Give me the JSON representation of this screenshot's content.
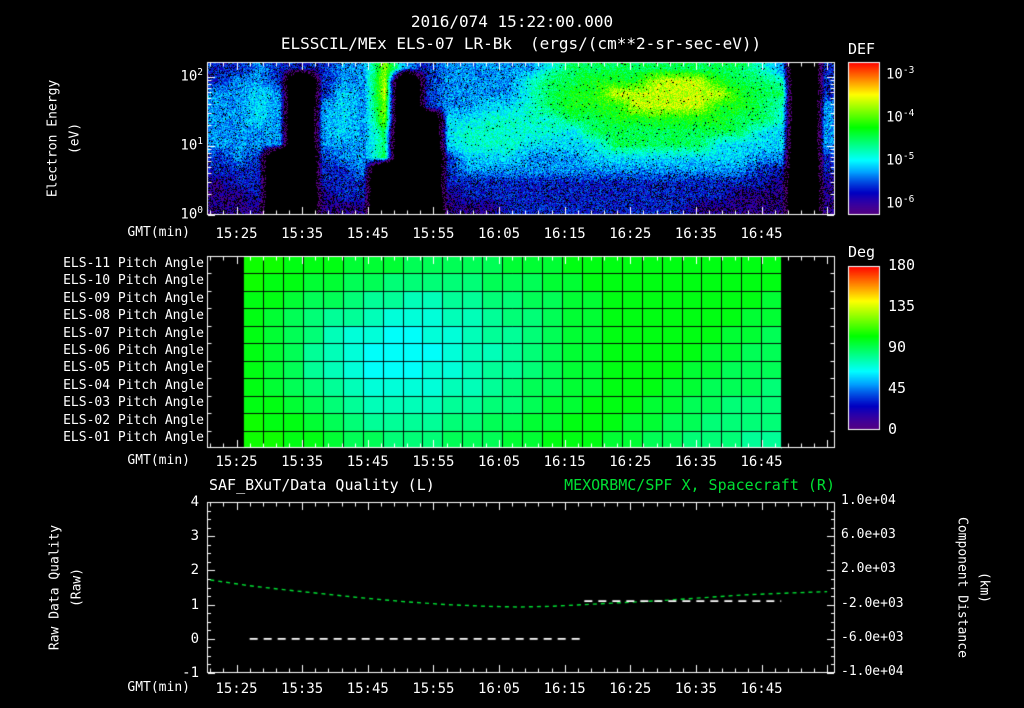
{
  "header": {
    "datetime": "2016/074 15:22:00.000",
    "instrument_title": "ELSSCIL/MEx ELS-07 LR-Bk",
    "units_title": "(ergs/(cm**2-sr-sec-eV))"
  },
  "time_axis": {
    "label": "GMT(min)",
    "tick_labels": [
      "15:25",
      "15:35",
      "15:45",
      "15:55",
      "16:05",
      "16:15",
      "16:25",
      "16:35",
      "16:45"
    ]
  },
  "spectrogram_panel": {
    "ylabel": "Electron Energy",
    "ylabel_units": "(eV)",
    "ytick_exponents": [
      "2",
      "1",
      "0"
    ],
    "colorbar_title": "DEF",
    "colorbar_tick_exponents": [
      "-3",
      "-4",
      "-5",
      "-6"
    ]
  },
  "pitch_panel": {
    "row_labels": [
      "ELS-11 Pitch Angle",
      "ELS-10 Pitch Angle",
      "ELS-09 Pitch Angle",
      "ELS-08 Pitch Angle",
      "ELS-07 Pitch Angle",
      "ELS-06 Pitch Angle",
      "ELS-05 Pitch Angle",
      "ELS-04 Pitch Angle",
      "ELS-03 Pitch Angle",
      "ELS-02 Pitch Angle",
      "ELS-01 Pitch Angle"
    ],
    "colorbar_title": "Deg",
    "colorbar_ticks": [
      "180",
      "135",
      "90",
      "45",
      "0"
    ]
  },
  "bottom_panel": {
    "title_left": "SAF_BXuT/Data Quality (L)",
    "title_right": "MEXORBMC/SPF X, Spacecraft (R)",
    "ylabel_left": "Raw Data Quality",
    "ylabel_left_units": "(Raw)",
    "ylabel_right": "Component Distance",
    "ylabel_right_units": "(km)",
    "left_ticks": [
      "4",
      "3",
      "2",
      "1",
      "0",
      "-1"
    ],
    "right_ticks": [
      "1.0e+04",
      "6.0e+03",
      "2.0e+03",
      "-2.0e+03",
      "-6.0e+03",
      "-1.0e+04"
    ]
  },
  "colors": {
    "background": "#000000",
    "text": "#ffffff",
    "accent_green": "#00e033"
  },
  "chart_data": [
    {
      "id": "electron_energy_spectrogram",
      "type": "heatmap",
      "title": "ELSSCIL/MEx ELS-07 LR-Bk",
      "units": "ergs/(cm**2-sr-sec-eV)",
      "x_range": [
        "15:20",
        "16:56"
      ],
      "x_tick_labels": [
        "15:25",
        "15:35",
        "15:45",
        "15:55",
        "16:05",
        "16:15",
        "16:25",
        "16:35",
        "16:45"
      ],
      "y_scale": "log",
      "y_range_ev": [
        1,
        165
      ],
      "value_scale": "log10(DEF)",
      "value_range": [
        -6,
        -3
      ],
      "rows_top_to_bottom_ev": [
        160,
        100,
        63,
        40,
        25,
        16,
        10,
        6.3,
        4,
        2.5,
        1.6,
        1
      ],
      "no_data_value": -9,
      "values_log10": [
        [
          -5.5,
          -5.5,
          -5.2,
          -5.5,
          -5.5,
          -5.5,
          -5.2,
          -5.2,
          -4.0,
          -5.2,
          -5.5,
          -5.2,
          -5.2,
          -5.2,
          -5.2,
          -5.2,
          -4.8,
          -4.5,
          -4.5,
          -4.5,
          -4.5,
          -4.5,
          -4.5,
          -4.5,
          -4.5,
          -4.5,
          -4.8,
          -5.2,
          -9,
          -5.5
        ],
        [
          -5.5,
          -5.2,
          -5.2,
          -5.5,
          -9,
          -5.5,
          -5.2,
          -5.2,
          -3.8,
          -9,
          -5.5,
          -5.2,
          -5.2,
          -5.2,
          -5.2,
          -4.8,
          -4.5,
          -4.5,
          -4.3,
          -4.3,
          -4.3,
          -3.8,
          -3.8,
          -3.8,
          -4.3,
          -4.5,
          -4.5,
          -4.8,
          -9,
          -5.5
        ],
        [
          -5.2,
          -5.2,
          -5.0,
          -5.2,
          -9,
          -5.5,
          -5.0,
          -5.2,
          -3.8,
          -9,
          -5.5,
          -5.2,
          -5.2,
          -5.2,
          -5.2,
          -4.8,
          -4.5,
          -4.3,
          -4.3,
          -3.8,
          -3.8,
          -3.8,
          -3.8,
          -3.8,
          -3.8,
          -4.3,
          -4.5,
          -4.5,
          -9,
          -5.5
        ],
        [
          -5.2,
          -5.2,
          -5.0,
          -5.2,
          -9,
          -5.2,
          -5.0,
          -5.2,
          -4.0,
          -9,
          -5.5,
          -5.2,
          -5.2,
          -5.0,
          -5.0,
          -4.8,
          -4.5,
          -4.3,
          -4.3,
          -4.3,
          -3.8,
          -3.8,
          -3.8,
          -3.8,
          -4.3,
          -4.3,
          -4.5,
          -4.8,
          -9,
          -5.2
        ],
        [
          -5.2,
          -5.2,
          -5.0,
          -5.2,
          -9,
          -5.2,
          -5.0,
          -5.2,
          -4.0,
          -9,
          -9,
          -5.0,
          -5.0,
          -4.8,
          -4.8,
          -4.8,
          -4.8,
          -4.5,
          -4.5,
          -4.3,
          -4.3,
          -4.3,
          -4.3,
          -4.3,
          -4.3,
          -4.5,
          -4.5,
          -4.8,
          -9,
          -5.2
        ],
        [
          -5.2,
          -5.2,
          -5.2,
          -5.2,
          -9,
          -5.2,
          -5.0,
          -5.2,
          -4.5,
          -9,
          -9,
          -5.0,
          -4.8,
          -4.8,
          -4.8,
          -4.8,
          -4.8,
          -5.0,
          -4.5,
          -4.5,
          -4.5,
          -4.5,
          -4.5,
          -4.5,
          -4.5,
          -4.5,
          -5.0,
          -5.0,
          -9,
          -5.2
        ],
        [
          -5.2,
          -5.2,
          -5.2,
          -5.2,
          -9,
          -5.2,
          -5.2,
          -5.2,
          -4.5,
          -9,
          -9,
          -5.0,
          -4.8,
          -4.8,
          -4.8,
          -5.0,
          -5.0,
          -5.0,
          -5.0,
          -4.5,
          -4.5,
          -4.5,
          -4.5,
          -4.5,
          -5.0,
          -5.0,
          -5.0,
          -5.0,
          -9,
          -5.2
        ],
        [
          -5.5,
          -5.2,
          -5.5,
          -9,
          -9,
          -5.5,
          -5.2,
          -5.2,
          -4.5,
          -9,
          -9,
          -5.5,
          -5.0,
          -5.0,
          -5.0,
          -5.2,
          -5.2,
          -5.2,
          -5.0,
          -5.0,
          -5.0,
          -5.0,
          -5.0,
          -5.0,
          -5.0,
          -5.0,
          -5.2,
          -5.2,
          -9,
          -5.5
        ],
        [
          -5.5,
          -5.5,
          -5.5,
          -9,
          -9,
          -5.5,
          -5.5,
          -5.2,
          -9,
          -9,
          -9,
          -5.5,
          -5.2,
          -5.2,
          -5.2,
          -5.2,
          -5.2,
          -5.2,
          -5.2,
          -5.2,
          -5.2,
          -5.2,
          -5.2,
          -5.2,
          -5.2,
          -5.2,
          -5.5,
          -5.5,
          -9,
          -5.5
        ],
        [
          -5.8,
          -5.5,
          -5.5,
          -9,
          -9,
          -5.5,
          -5.5,
          -5.5,
          -9,
          -9,
          -9,
          -5.5,
          -5.5,
          -5.5,
          -5.5,
          -5.5,
          -5.5,
          -5.5,
          -5.5,
          -5.5,
          -5.5,
          -5.5,
          -5.5,
          -5.5,
          -5.5,
          -5.5,
          -5.5,
          -5.8,
          -9,
          -5.8
        ],
        [
          -5.8,
          -5.8,
          -5.5,
          -9,
          -9,
          -5.8,
          -5.5,
          -5.5,
          -9,
          -9,
          -9,
          -5.8,
          -5.5,
          -5.5,
          -5.5,
          -5.5,
          -5.5,
          -5.5,
          -5.5,
          -5.5,
          -5.5,
          -5.5,
          -5.5,
          -5.5,
          -5.5,
          -5.8,
          -5.8,
          -5.8,
          -9,
          -5.8
        ],
        [
          -5.8,
          -5.8,
          -5.8,
          -9,
          -9,
          -5.8,
          -5.8,
          -5.8,
          -9,
          -9,
          -9,
          -5.8,
          -5.8,
          -5.8,
          -5.5,
          -5.5,
          -5.5,
          -5.5,
          -5.5,
          -5.5,
          -5.5,
          -5.5,
          -5.5,
          -5.8,
          -5.8,
          -5.8,
          -5.8,
          -5.8,
          -9,
          -5.8
        ]
      ]
    },
    {
      "id": "pitch_angle_panel",
      "type": "heatmap",
      "x_range": [
        "15:26",
        "16:48"
      ],
      "value_units": "Deg",
      "value_range": [
        0,
        180
      ],
      "rows_top_to_bottom": [
        "ELS-11",
        "ELS-10",
        "ELS-09",
        "ELS-08",
        "ELS-07",
        "ELS-06",
        "ELS-05",
        "ELS-04",
        "ELS-03",
        "ELS-02",
        "ELS-01"
      ],
      "values_deg": [
        [
          105,
          105,
          100,
          100,
          100,
          95,
          95,
          95,
          90,
          90,
          90,
          90,
          90,
          95,
          95,
          95,
          100,
          100,
          100,
          100,
          100,
          100,
          100,
          100,
          100,
          100,
          100
        ],
        [
          105,
          100,
          100,
          95,
          95,
          90,
          90,
          85,
          85,
          85,
          85,
          85,
          90,
          90,
          90,
          95,
          95,
          100,
          100,
          100,
          100,
          100,
          100,
          100,
          100,
          100,
          100
        ],
        [
          100,
          100,
          95,
          90,
          90,
          85,
          80,
          80,
          75,
          75,
          80,
          80,
          85,
          85,
          90,
          90,
          95,
          95,
          100,
          100,
          100,
          100,
          100,
          100,
          100,
          100,
          95
        ],
        [
          100,
          95,
          90,
          85,
          80,
          80,
          75,
          70,
          70,
          70,
          75,
          75,
          80,
          85,
          85,
          90,
          95,
          95,
          100,
          100,
          100,
          100,
          100,
          100,
          100,
          95,
          95
        ],
        [
          100,
          95,
          90,
          85,
          75,
          70,
          70,
          65,
          65,
          70,
          70,
          75,
          80,
          80,
          85,
          90,
          95,
          95,
          100,
          100,
          100,
          100,
          100,
          100,
          95,
          95,
          90
        ],
        [
          100,
          95,
          90,
          80,
          75,
          70,
          65,
          65,
          65,
          65,
          70,
          75,
          75,
          80,
          85,
          90,
          95,
          95,
          100,
          100,
          100,
          100,
          100,
          95,
          95,
          90,
          90
        ],
        [
          100,
          95,
          90,
          80,
          75,
          70,
          65,
          65,
          65,
          70,
          70,
          75,
          80,
          80,
          85,
          90,
          95,
          95,
          100,
          100,
          100,
          100,
          95,
          95,
          90,
          90,
          90
        ],
        [
          100,
          95,
          90,
          85,
          80,
          75,
          70,
          70,
          70,
          70,
          75,
          75,
          80,
          85,
          90,
          90,
          95,
          95,
          100,
          100,
          100,
          95,
          95,
          90,
          90,
          90,
          85
        ],
        [
          100,
          100,
          95,
          90,
          85,
          80,
          75,
          75,
          75,
          75,
          80,
          80,
          85,
          85,
          90,
          95,
          95,
          100,
          100,
          100,
          95,
          95,
          90,
          90,
          85,
          85,
          85
        ],
        [
          105,
          100,
          100,
          95,
          90,
          85,
          80,
          80,
          80,
          80,
          85,
          85,
          90,
          90,
          95,
          95,
          100,
          100,
          100,
          95,
          95,
          90,
          90,
          85,
          85,
          85,
          85
        ],
        [
          105,
          105,
          100,
          100,
          95,
          90,
          90,
          85,
          85,
          85,
          90,
          90,
          90,
          95,
          95,
          100,
          100,
          100,
          95,
          95,
          90,
          90,
          85,
          85,
          85,
          80,
          80
        ]
      ]
    },
    {
      "id": "quality_and_distance",
      "type": "line",
      "title_left": "SAF_BXuT/Data Quality (L)",
      "title_right": "MEXORBMC/SPF X, Spacecraft (R)",
      "left_axis": {
        "label": "Raw Data Quality (Raw)",
        "range": [
          -1,
          4
        ]
      },
      "right_axis": {
        "label": "Component Distance (km)",
        "range": [
          -10000,
          10000
        ]
      },
      "series": [
        {
          "name": "SAF_BXuT/Data Quality",
          "axis": "left",
          "color": "#ffffff",
          "line_style": "dashed",
          "segments": [
            {
              "points": [
                [
                  "15:27",
                  0
                ],
                [
                  "16:18",
                  0
                ]
              ]
            },
            {
              "points": [
                [
                  "16:18",
                  1.1
                ],
                [
                  "16:48",
                  1.1
                ]
              ]
            }
          ]
        },
        {
          "name": "MEXORBMC/SPF X, Spacecraft",
          "axis": "right",
          "color": "#00e033",
          "line_style": "dashed",
          "points": [
            [
              "15:21",
              880
            ],
            [
              "15:27",
              200
            ],
            [
              "15:33",
              -320
            ],
            [
              "15:39",
              -800
            ],
            [
              "15:45",
              -1280
            ],
            [
              "15:51",
              -1680
            ],
            [
              "15:57",
              -2000
            ],
            [
              "16:03",
              -2200
            ],
            [
              "16:08",
              -2280
            ],
            [
              "16:13",
              -2200
            ],
            [
              "16:18",
              -2000
            ],
            [
              "16:24",
              -1760
            ],
            [
              "16:30",
              -1520
            ],
            [
              "16:36",
              -1200
            ],
            [
              "16:42",
              -880
            ],
            [
              "16:48",
              -680
            ],
            [
              "16:55",
              -480
            ]
          ]
        }
      ]
    }
  ]
}
